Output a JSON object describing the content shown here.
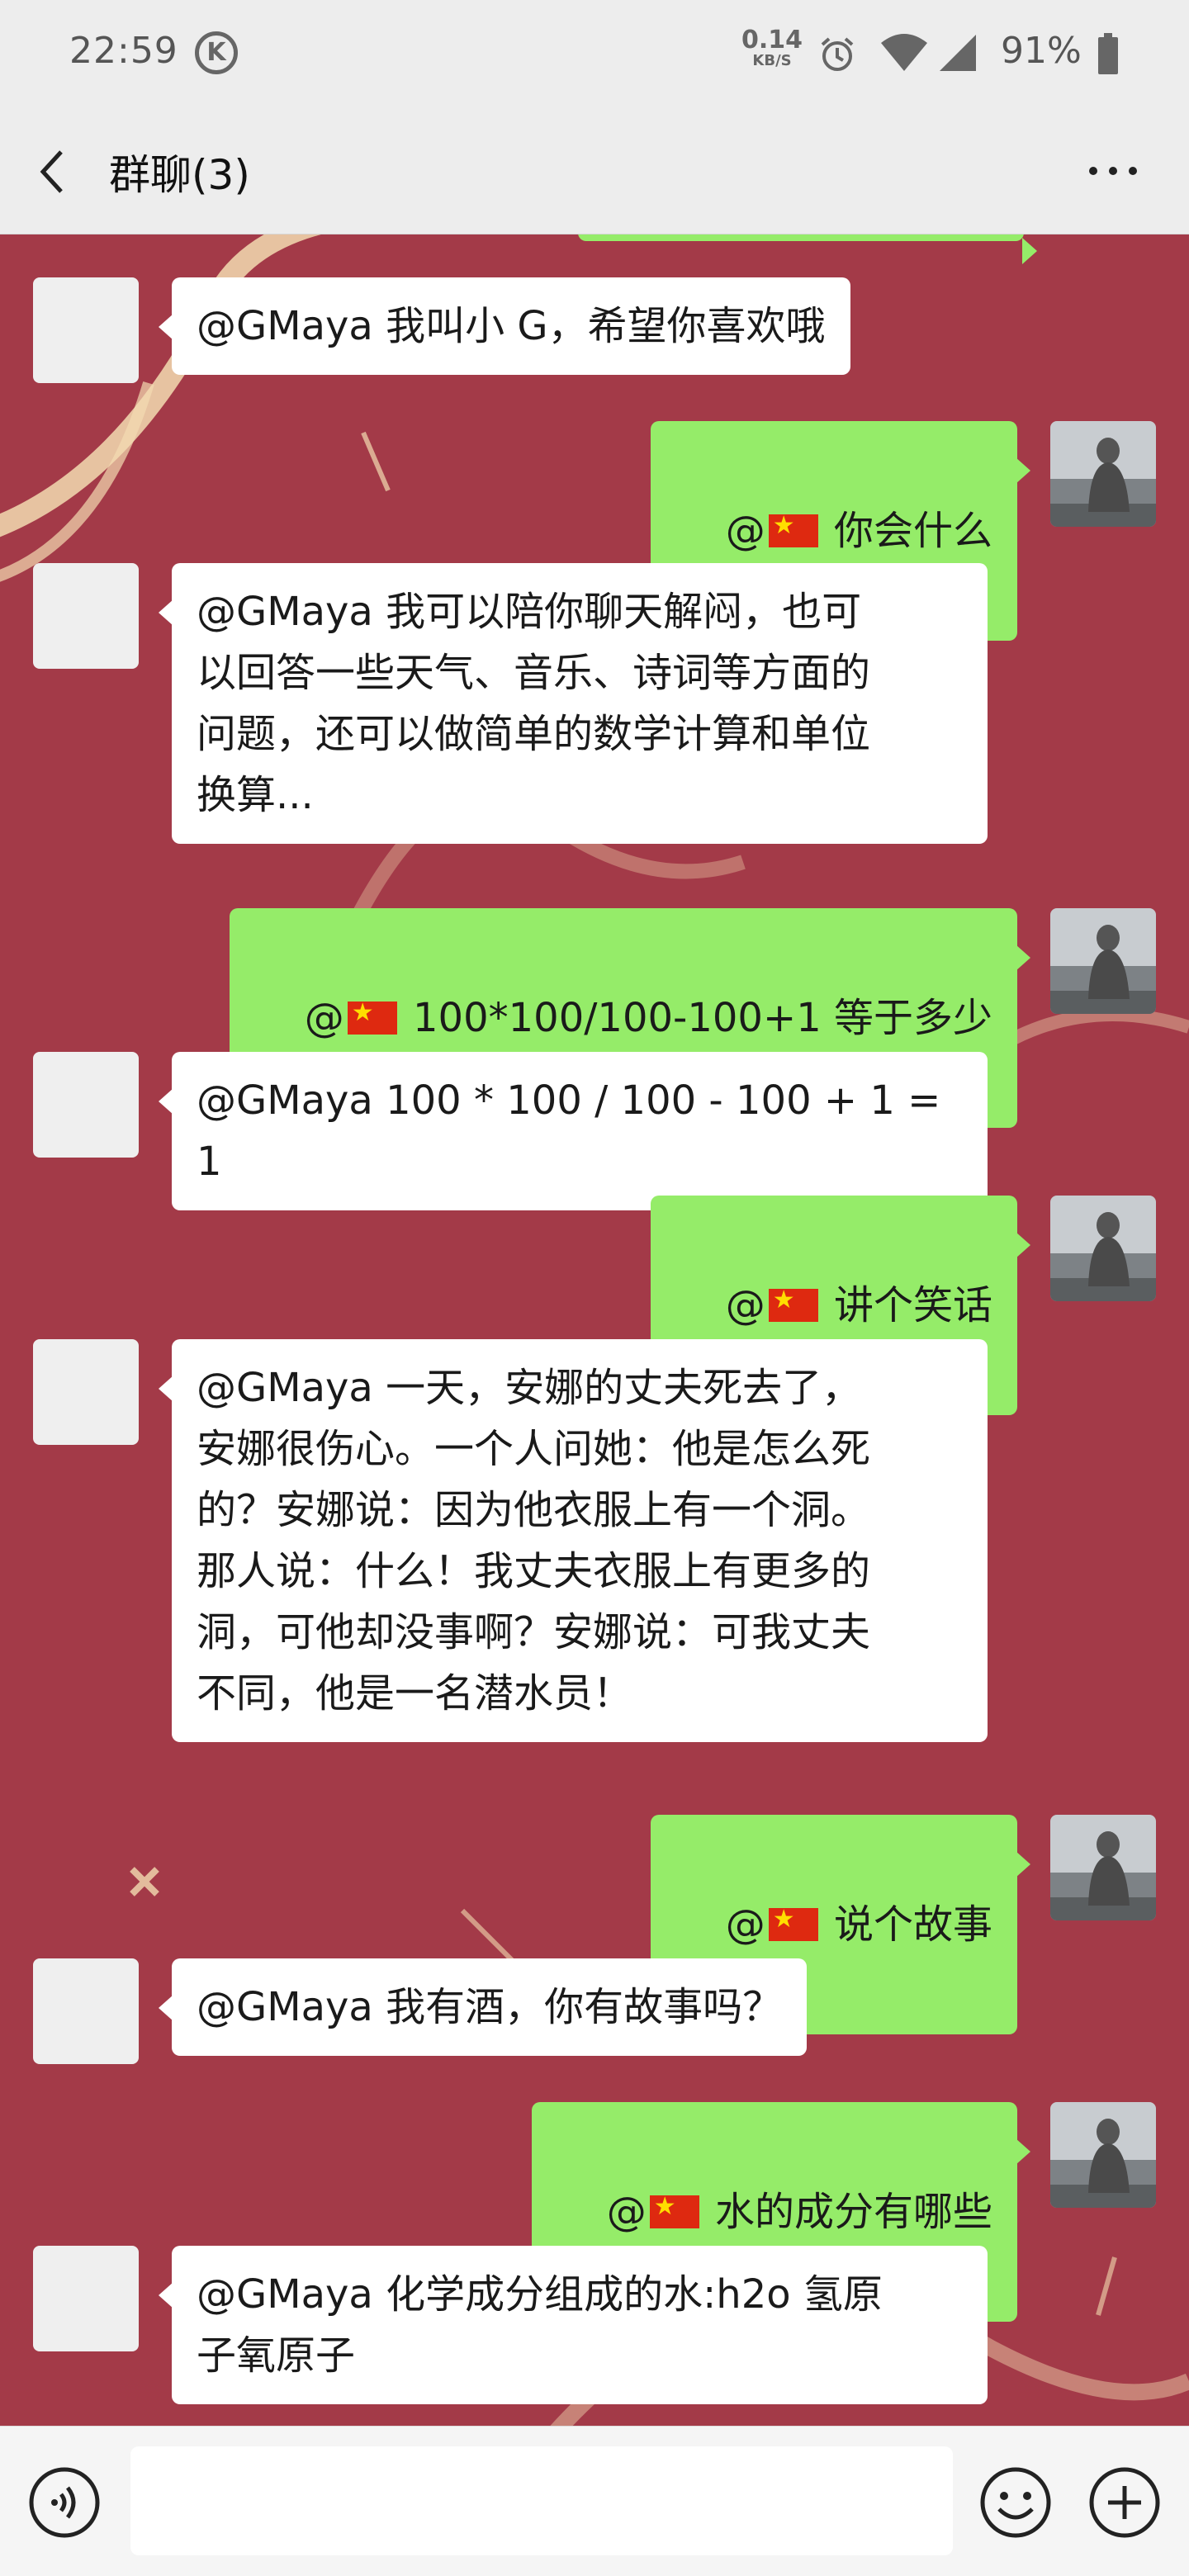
{
  "status_bar": {
    "time": "22:59",
    "k_icon": "K",
    "net_speed_value": "0.14",
    "net_speed_unit": "KB/S",
    "battery_percent": "91%",
    "icons": [
      "alarm-icon",
      "wifi-icon",
      "signal-icon",
      "battery-icon"
    ]
  },
  "header": {
    "title": "群聊(3)",
    "back_icon": "chevron-left-icon",
    "more_icon": "more-dots-icon"
  },
  "messages": [
    {
      "side": "left",
      "text": "@GMaya 我叫小 G，希望你喜欢哦"
    },
    {
      "side": "right",
      "mention": "@",
      "text": " 你会什么"
    },
    {
      "side": "left",
      "text": "@GMaya 我可以陪你聊天解闷，也可\n以回答一些天气、音乐、诗词等方面的\n问题，还可以做简单的数学计算和单位\n换算..."
    },
    {
      "side": "right",
      "mention": "@",
      "text": " 100*100/100-100+1 等于多少"
    },
    {
      "side": "left",
      "text": "@GMaya 100 * 100 / 100 - 100 + 1 = 1"
    },
    {
      "side": "right",
      "mention": "@",
      "text": " 讲个笑话"
    },
    {
      "side": "left",
      "text": "@GMaya 一天，安娜的丈夫死去了，\n安娜很伤心。一个人问她：他是怎么死\n的？安娜说：因为他衣服上有一个洞。\n那人说：什么！我丈夫衣服上有更多的\n洞，可他却没事啊？安娜说：可我丈夫\n不同，他是一名潜水员！"
    },
    {
      "side": "right",
      "mention": "@",
      "text": " 说个故事"
    },
    {
      "side": "left",
      "text": "@GMaya 我有酒，你有故事吗？"
    },
    {
      "side": "right",
      "mention": "@",
      "text": " 水的成分有哪些"
    },
    {
      "side": "left",
      "text": "@GMaya 化学成分组成的水:h2o 氢原\n子氧原子"
    }
  ],
  "input_bar": {
    "placeholder": "",
    "icons": [
      "voice-icon",
      "emoji-icon",
      "plus-icon"
    ]
  },
  "colors": {
    "chat_background": "#a33a48",
    "self_bubble": "#95ec69",
    "other_bubble": "#ffffff",
    "bar_background": "#ededed"
  }
}
